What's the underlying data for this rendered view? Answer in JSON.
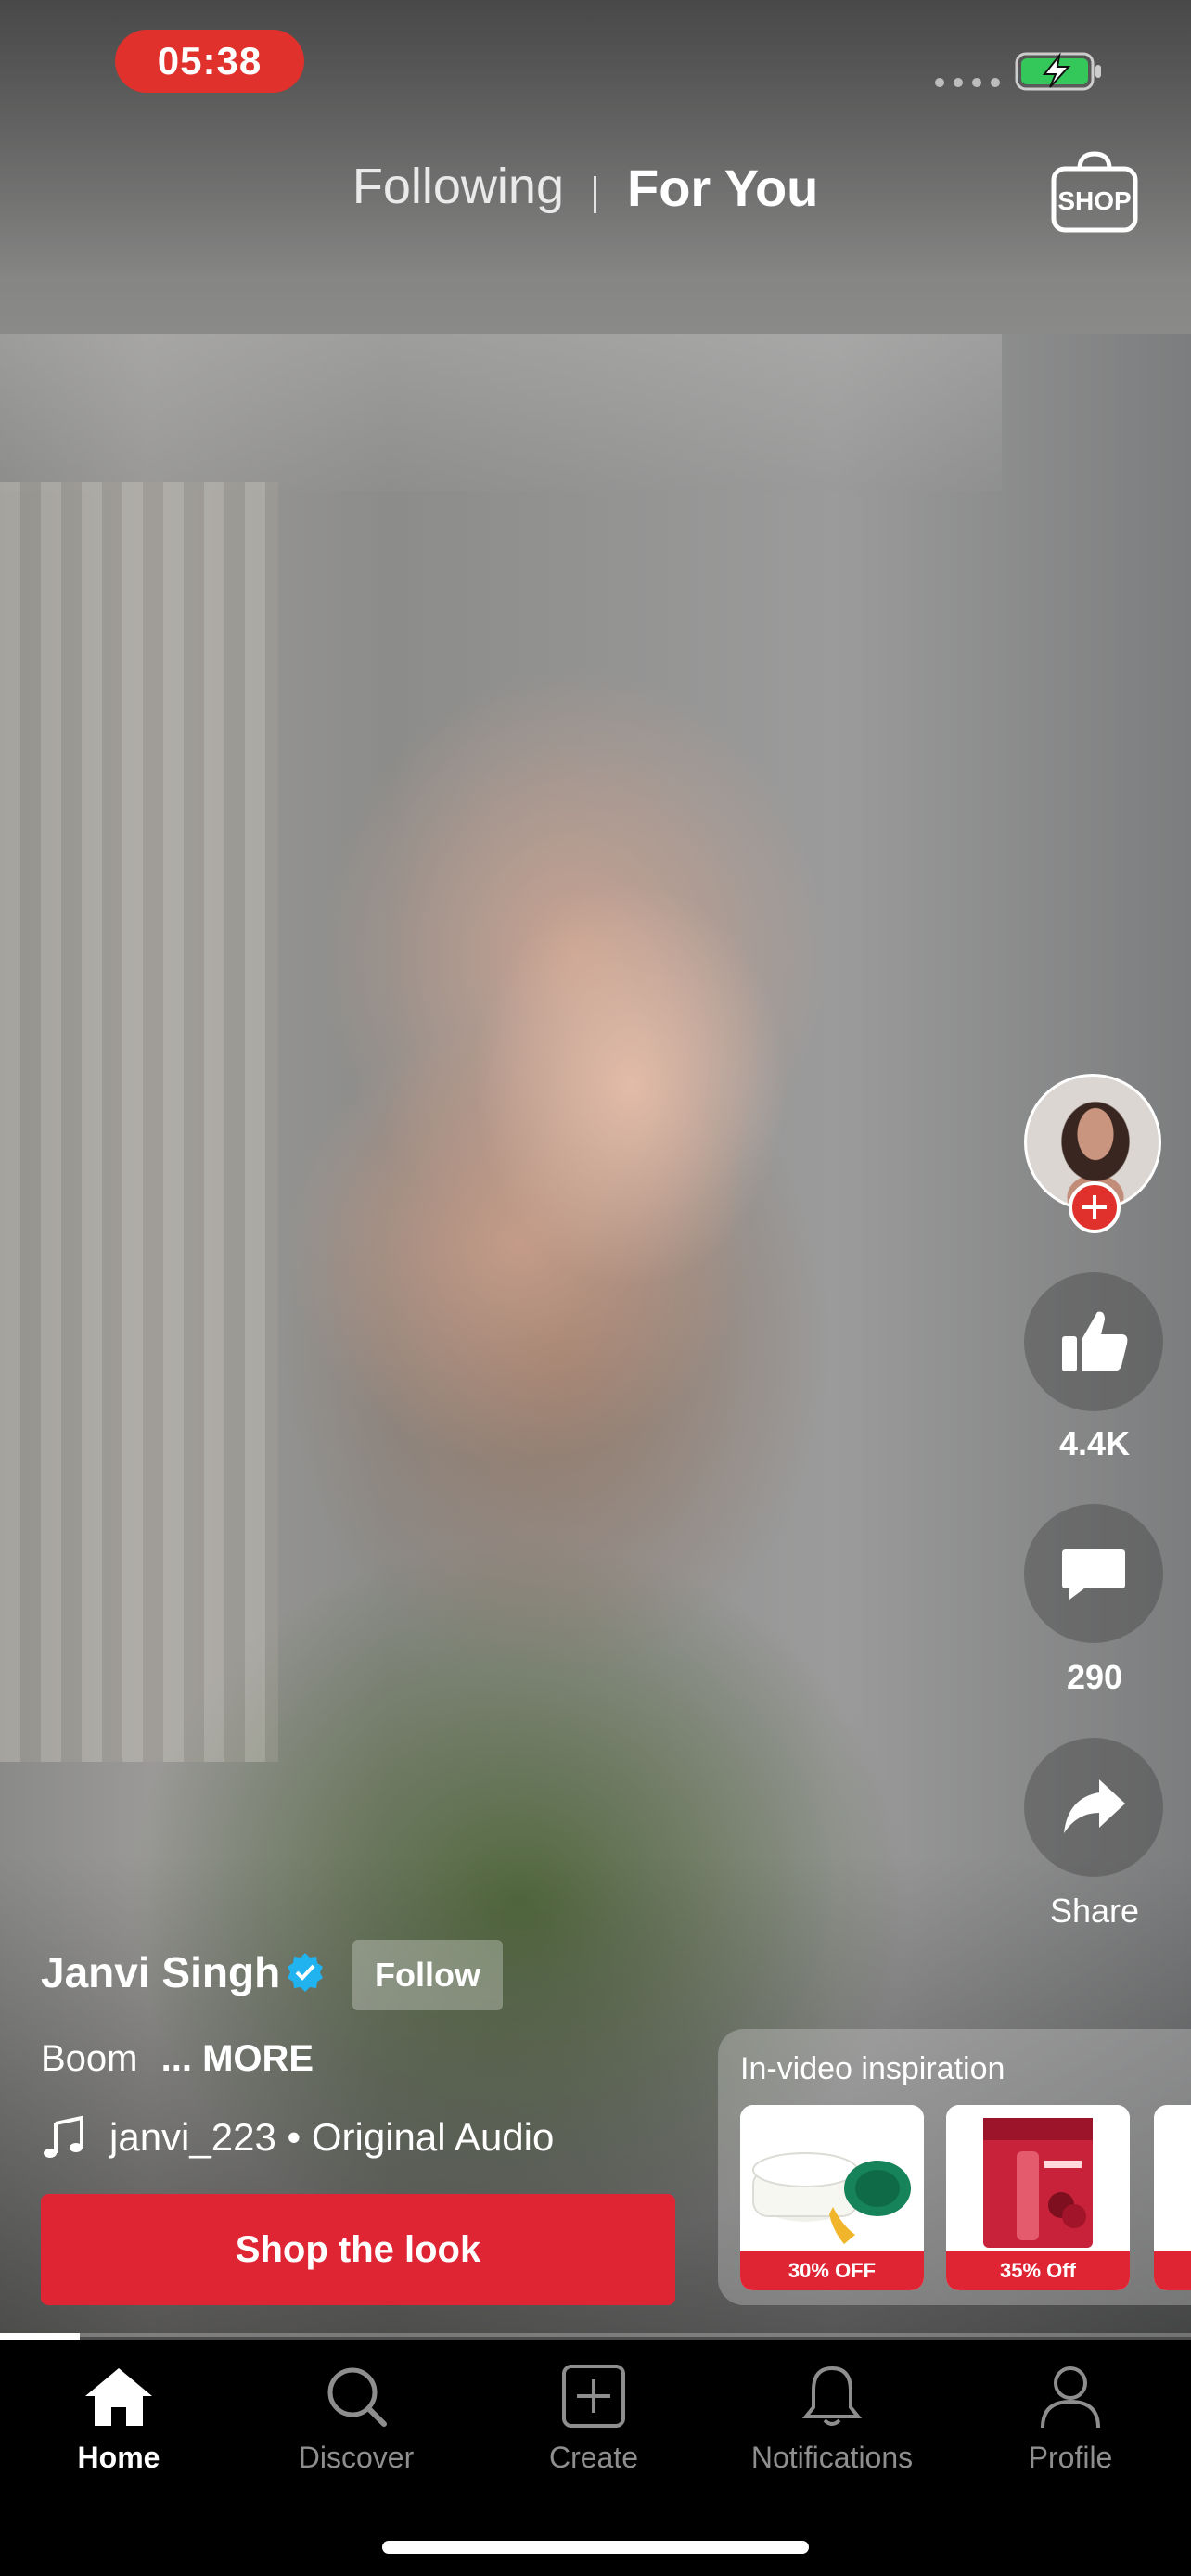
{
  "status_bar": {
    "time": "05:38"
  },
  "top_tabs": {
    "following": "Following",
    "for_you": "For You",
    "shop": "SHOP"
  },
  "actions": {
    "like_count": "4.4K",
    "comment_count": "290",
    "share_label": "Share"
  },
  "post": {
    "username": "Janvi Singh",
    "follow_label": "Follow",
    "caption": "Boom",
    "more_label": "... MORE",
    "audio": "janvi_223 • Original Audio",
    "shop_label": "Shop the look"
  },
  "inspiration": {
    "title": "In-video inspiration",
    "products": [
      {
        "discount": "30% OFF"
      },
      {
        "discount": "35% Off"
      }
    ]
  },
  "progress": {
    "fraction": 0.067
  },
  "nav": {
    "home": "Home",
    "discover": "Discover",
    "create": "Create",
    "notifications": "Notifications",
    "profile": "Profile"
  },
  "colors": {
    "accent_red": "#df2534",
    "verified_blue": "#20b3ef"
  }
}
